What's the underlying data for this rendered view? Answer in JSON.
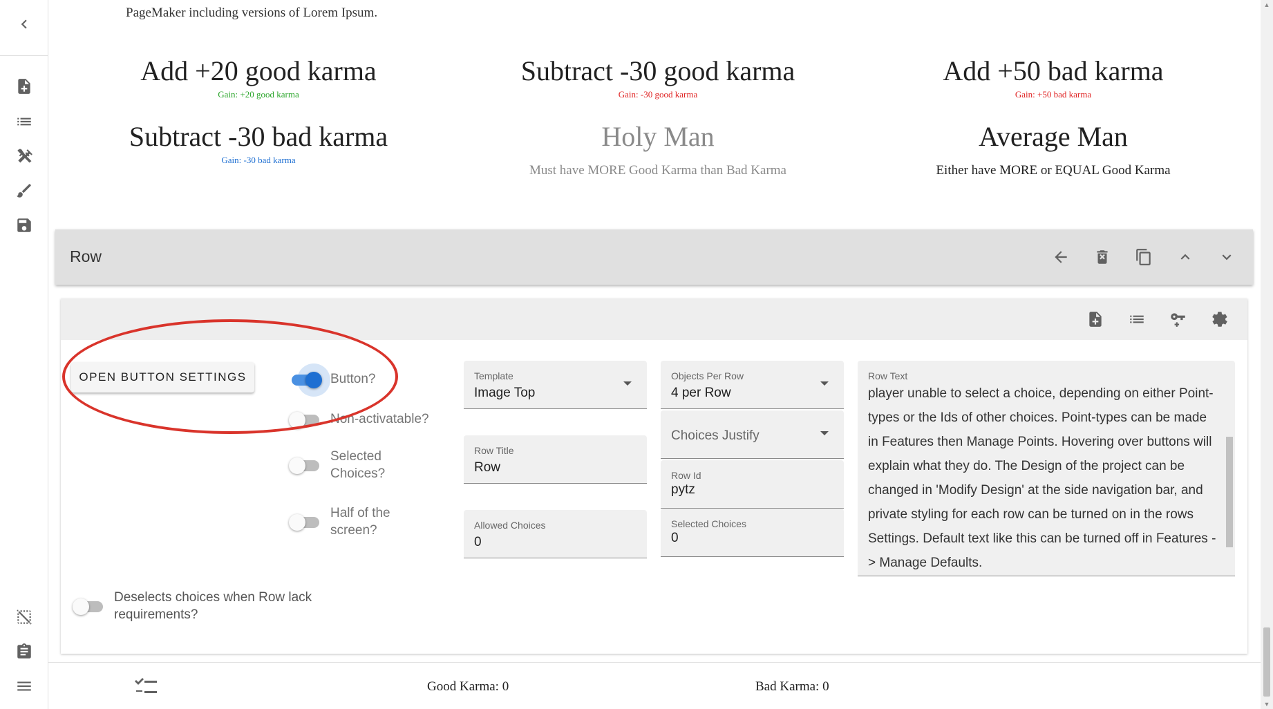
{
  "nav": {
    "icons": [
      "chevron-left-icon",
      "new-document-icon",
      "list-icon",
      "tools-icon",
      "brush-icon",
      "save-icon",
      "deselect-icon",
      "clipboard-icon",
      "menu-icon"
    ]
  },
  "intro_text": "PageMaker including versions of Lorem Ipsum.",
  "choices": [
    {
      "title": "Add +20 good karma",
      "gain": "Gain: +20  good karma",
      "gain_color": "#2aa52a"
    },
    {
      "title": "Subtract -30 good karma",
      "gain": "Gain: -30  good karma",
      "gain_color": "#e02424"
    },
    {
      "title": "Add +50 bad karma",
      "gain": "Gain: +50 bad karma",
      "gain_color": "#e02424"
    },
    {
      "title": "Subtract -30 bad karma",
      "gain": "Gain: -30 bad karma",
      "gain_color": "#1e6fd2"
    },
    {
      "title": "Holy Man",
      "desc": "Must have MORE Good Karma than Bad Karma"
    },
    {
      "title": "Average Man",
      "desc": "Either have MORE or EQUAL Good Karma"
    }
  ],
  "row_toolbar": {
    "title": "Row",
    "icons": [
      "arrow-left-icon",
      "delete-icon",
      "copy-icon",
      "chevron-up-icon",
      "chevron-down-icon"
    ]
  },
  "settings": {
    "header_icons": [
      "add-document-icon",
      "list-icon",
      "key-plus-icon",
      "settings-icon"
    ],
    "open_button": "OPEN BUTTON SETTINGS",
    "toggles": {
      "button": {
        "label": "Button?",
        "on": true
      },
      "non_activatable": {
        "label": "Non-activatable?",
        "on": false
      },
      "selected_choices": {
        "label": "Selected Choices?",
        "on": false
      },
      "half_screen": {
        "label": "Half of the screen?",
        "on": false
      },
      "deselect": {
        "label": "Deselects choices when Row lack requirements?",
        "on": false
      }
    },
    "template": {
      "label": "Template",
      "value": "Image Top"
    },
    "row_title": {
      "label": "Row Title",
      "value": "Row"
    },
    "allowed_choices": {
      "label": "Allowed Choices",
      "value": "0"
    },
    "objects_per_row": {
      "label": "Objects Per Row",
      "value": "4 per Row"
    },
    "choices_justify": {
      "placeholder": "Choices Justify"
    },
    "row_id": {
      "label": "Row Id",
      "value": "pytz"
    },
    "selected_choices_field": {
      "label": "Selected Choices",
      "value": "0"
    },
    "row_text": {
      "label": "Row Text",
      "value": "player unable to select a choice, depending on either Point-types or the Ids of other choices. Point-types can be made in Features then Manage Points. Hovering over buttons will explain what they do. The Design of the project can be changed in 'Modify Design' at the side navigation bar, and private styling for each row can be turned on in the rows Settings. Default text like this can be turned off in Features -> Manage Defaults."
    }
  },
  "footer": {
    "icon": "checklist-icon",
    "good_karma": "Good Karma: 0",
    "bad_karma": "Bad Karma: 0"
  },
  "colors": {
    "accent": "#1e6fd2",
    "annotation": "#d9342b"
  }
}
